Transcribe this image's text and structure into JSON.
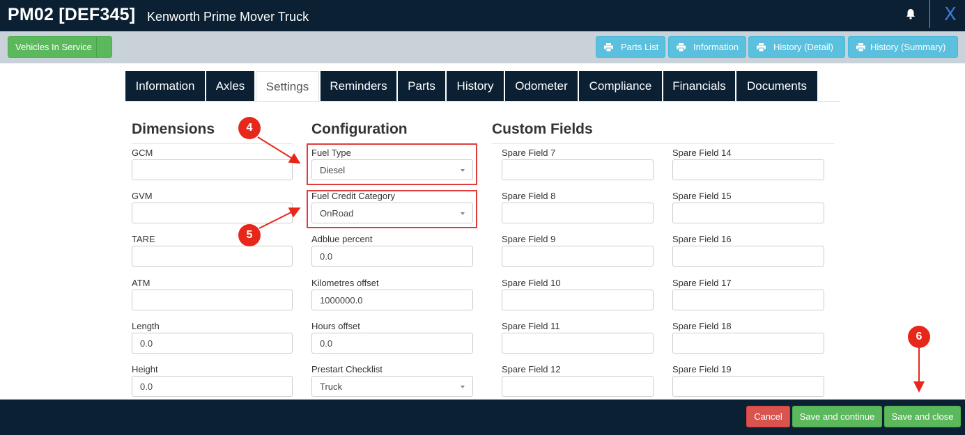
{
  "header": {
    "code": "PM02 [DEF345]",
    "description": "Kenworth Prime Mover Truck",
    "icons": [
      "bell-icon",
      "close-icon"
    ],
    "close_label": "X"
  },
  "toolbar": {
    "vehicles_button": "Vehicles In Service",
    "print_buttons": [
      "Parts List",
      "Information",
      "History (Detail)",
      "History (Summary)"
    ]
  },
  "tabs": [
    {
      "label": "Information"
    },
    {
      "label": "Axles"
    },
    {
      "label": "Settings",
      "active": true
    },
    {
      "label": "Reminders"
    },
    {
      "label": "Parts"
    },
    {
      "label": "History"
    },
    {
      "label": "Odometer"
    },
    {
      "label": "Compliance"
    },
    {
      "label": "Financials"
    },
    {
      "label": "Documents"
    }
  ],
  "dimensions": {
    "title": "Dimensions",
    "fields": [
      {
        "label": "GCM",
        "value": ""
      },
      {
        "label": "GVM",
        "value": ""
      },
      {
        "label": "TARE",
        "value": ""
      },
      {
        "label": "ATM",
        "value": ""
      },
      {
        "label": "Length",
        "value": "0.0"
      },
      {
        "label": "Height",
        "value": "0.0"
      }
    ]
  },
  "configuration": {
    "title": "Configuration",
    "fields": [
      {
        "label": "Fuel Type",
        "value": "Diesel",
        "type": "select"
      },
      {
        "label": "Fuel Credit Category",
        "value": "OnRoad",
        "type": "select"
      },
      {
        "label": "Adblue percent",
        "value": "0.0",
        "type": "input"
      },
      {
        "label": "Kilometres offset",
        "value": "1000000.0",
        "type": "input"
      },
      {
        "label": "Hours offset",
        "value": "0.0",
        "type": "input"
      },
      {
        "label": "Prestart Checklist",
        "value": "Truck",
        "type": "select"
      }
    ]
  },
  "custom_fields": {
    "title": "Custom Fields",
    "left": [
      {
        "label": "Spare Field 7",
        "value": ""
      },
      {
        "label": "Spare Field 8",
        "value": ""
      },
      {
        "label": "Spare Field 9",
        "value": ""
      },
      {
        "label": "Spare Field 10",
        "value": ""
      },
      {
        "label": "Spare Field 11",
        "value": ""
      },
      {
        "label": "Spare Field 12",
        "value": ""
      }
    ],
    "right": [
      {
        "label": "Spare Field 14",
        "value": ""
      },
      {
        "label": "Spare Field 15",
        "value": ""
      },
      {
        "label": "Spare Field 16",
        "value": ""
      },
      {
        "label": "Spare Field 17",
        "value": ""
      },
      {
        "label": "Spare Field 18",
        "value": ""
      },
      {
        "label": "Spare Field 19",
        "value": ""
      }
    ]
  },
  "annotations": [
    "4",
    "5",
    "6"
  ],
  "footer": {
    "cancel": "Cancel",
    "save_continue": "Save and continue",
    "save_close": "Save and close"
  },
  "colors": {
    "navy": "#0b2133",
    "toolbar_bg": "#c9d2d9",
    "green": "#5cb85c",
    "blue": "#5bc0de",
    "red": "#d9534f",
    "annotation_red": "#e8271b"
  }
}
